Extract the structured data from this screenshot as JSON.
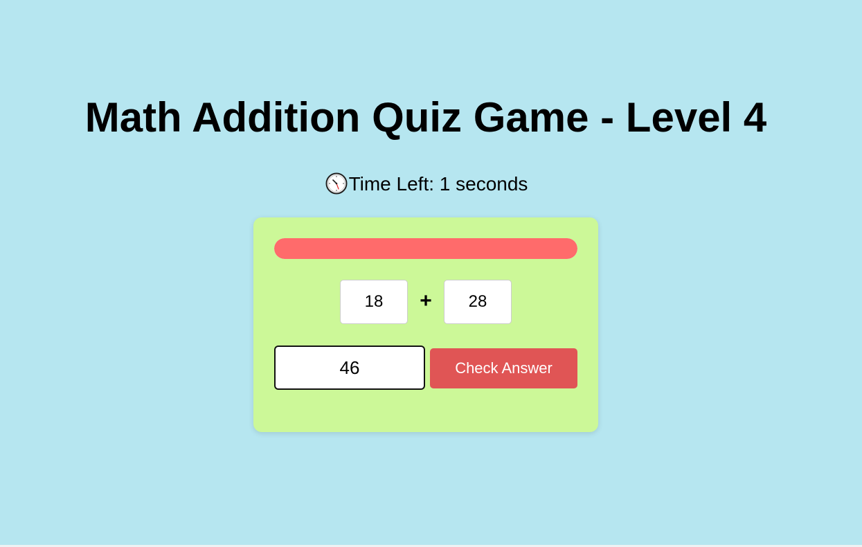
{
  "title": "Math Addition Quiz Game - Level 4",
  "timer": {
    "icon": "alarm-clock-icon",
    "text": "Time Left: 1 seconds"
  },
  "progress": {
    "fraction": 1.0,
    "color": "#ff6b6b"
  },
  "question": {
    "operand_a": "18",
    "operator": "+",
    "operand_b": "28"
  },
  "answer": {
    "value": "46"
  },
  "check_button": {
    "label": "Check Answer",
    "color": "#e05555"
  },
  "colors": {
    "background": "#b6e6f0",
    "card": "#ccf898"
  }
}
